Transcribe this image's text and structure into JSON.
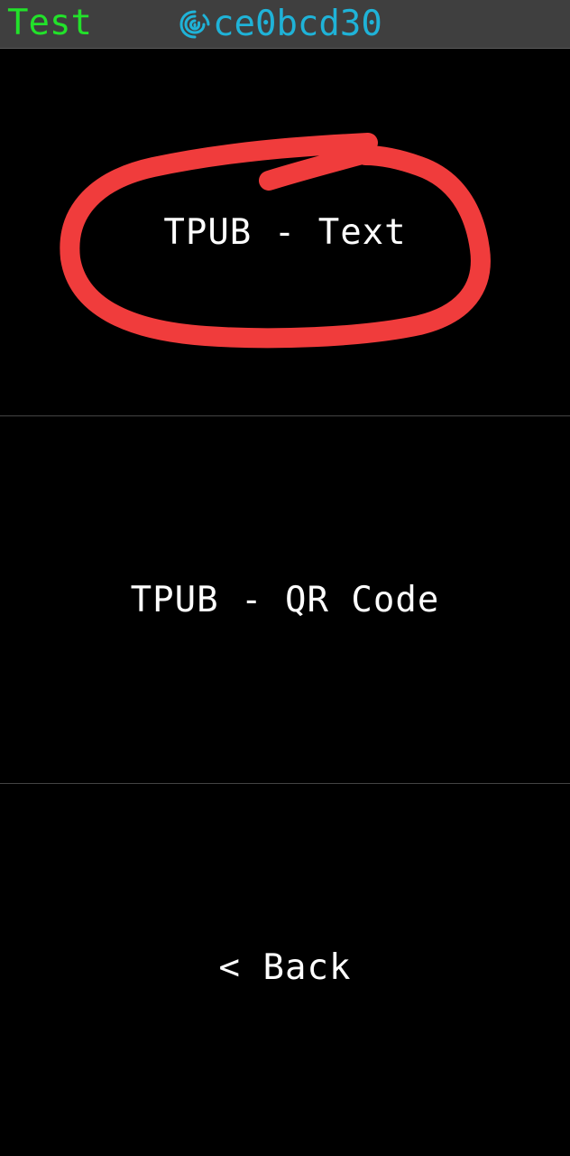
{
  "status_bar": {
    "network_name": "Test",
    "fingerprint_icon": "fingerprint-icon",
    "fingerprint": "ce0bcd30",
    "network_color": "#22e22a",
    "fingerprint_color": "#1fb3d8"
  },
  "menu": {
    "items": [
      {
        "label": "TPUB - Text"
      },
      {
        "label": "TPUB - QR Code"
      },
      {
        "label": "< Back"
      }
    ]
  },
  "annotation": {
    "shape": "hand-drawn circle",
    "color": "#f03c3c",
    "target": "TPUB - Text"
  }
}
